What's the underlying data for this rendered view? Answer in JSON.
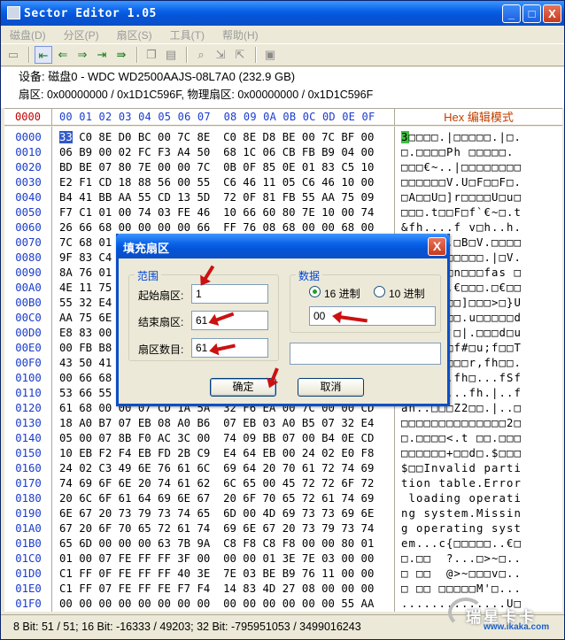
{
  "window": {
    "title": "Sector Editor 1.05",
    "buttons": {
      "minimize": "_",
      "maximize": "□",
      "close": "X"
    }
  },
  "menu": [
    "磁盘(D)",
    "分区(P)",
    "扇区(S)",
    "工具(T)",
    "帮助(H)"
  ],
  "info": {
    "line1": "设备: 磁盘0 - WDC WD2500AAJS-08L7A0 (232.9 GB)",
    "line2": "扇区: 0x00000000 / 0x1D1C596F, 物理扇区: 0x00000000 / 0x1D1C596F"
  },
  "hex_header": {
    "address_label": "0000",
    "columns": "00 01 02 03 04 05 06 07  08 09 0A 0B 0C 0D 0E 0F",
    "mode_label": "Hex 编辑模式"
  },
  "hex_rows": [
    {
      "addr": "0000",
      "first": "33",
      "hex": " C0 8E D0 BC 00 7C 8E  C0 8E D8 BE 00 7C BF 00",
      "text_first": "3",
      "text": "□□□□.|□□□□□.|□."
    },
    {
      "addr": "0010",
      "hex": "06 B9 00 02 FC F3 A4 50  68 1C 06 CB FB B9 04 00",
      "text": "□.□□□□Ph □□□□□."
    },
    {
      "addr": "0020",
      "hex": "BD BE 07 80 7E 00 00 7C  0B 0F 85 0E 01 83 C5 10",
      "text": "□□□€~..|□□□□□□□□"
    },
    {
      "addr": "0030",
      "hex": "E2 F1 CD 18 88 56 00 55  C6 46 11 05 C6 46 10 00",
      "text": "□□□□□□V.U□F□□F□."
    },
    {
      "addr": "0040",
      "hex": "B4 41 BB AA 55 CD 13 5D  72 0F 81 FB 55 AA 75 09",
      "text": "□A□□U□]r□□□□U□u□"
    },
    {
      "addr": "0050",
      "hex": "F7 C1 01 00 74 03 FE 46  10 66 60 80 7E 10 00 74",
      "text": "□□□.t□□F□f`€~□.t"
    },
    {
      "addr": "0060",
      "hex": "26 66 68 00 00 00 00 66  FF 76 08 68 00 00 68 00",
      "text": "&fh....f v□h..h."
    },
    {
      "addr": "0070",
      "hex": "7C 68 01 00 68 10 00 B4  42 8A 56 00 8B F4 CD 13",
      "text": "|h□.h□.□B□V.□□□□"
    },
    {
      "addr": "0080",
      "hex": "9F 83 C4 10 9E EB 14 B8  01 02 BB 00 7C 8A 56 00",
      "text": "□□□□□□□□□□□.|□V."
    },
    {
      "addr": "0090",
      "hex": "8A 76 01 8A 4E 02 8A 6E  03 CD 13 66 61 73 1C FE",
      "text": "□v□□N□□n□□□fas □"
    },
    {
      "addr": "00A0",
      "hex": "4E 11 75 0C 80 7E 00 80  0F 84 8A 00 B2 80 EB 84",
      "text": "N□u□€~.€□□□.□€□□"
    },
    {
      "addr": "00B0",
      "hex": "55 32 E4 8A 56 00 CD 13  5D EB 9E 81 3E FE 7D 55",
      "text": "U2□□V.□□]□□□>□}U"
    },
    {
      "addr": "00C0",
      "hex": "AA 75 6E FF 76 00 E8 8D  00 75 17 FA B0 D1 E6 64",
      "text": "□un□v.□□.u□□□□□d"
    },
    {
      "addr": "00D0",
      "hex": "E8 83 00 B0 DF E6 60 E8  7C 00 B0 FF E6 64 E8 75",
      "text": "□□.□□□`□|.□□□d□u"
    },
    {
      "addr": "00E0",
      "hex": "00 FB B8 00 BB CD 1A 66  23 C0 75 3B 66 81 FB 54",
      "text": ".□□.□□□f#□u;f□□T"
    },
    {
      "addr": "00F0",
      "hex": "43 50 41 75 32 81 F9 02  01 72 2C 66 68 07 BB 00",
      "text": "CPAu2□□□□r,fh□□."
    },
    {
      "addr": "0100",
      "hex": "00 66 68 00 02 00 00 66  68 08 00 00 00 66 53 66",
      "text": ".fh.□..fh□...fSf"
    },
    {
      "addr": "0110",
      "hex": "53 66 55 66 68 00 00 00  00 66 68 00 7C 00 00 66",
      "text": "SfUfh....fh.|..f"
    },
    {
      "addr": "0120",
      "hex": "61 68 00 00 07 CD 1A 5A  32 F6 EA 00 7C 00 00 CD",
      "text": "ah..□□□Z2□□.|..□"
    },
    {
      "addr": "0130",
      "hex": "18 A0 B7 07 EB 08 A0 B6  07 EB 03 A0 B5 07 32 E4",
      "text": "□□□□□□□□□□□□□□2□"
    },
    {
      "addr": "0140",
      "hex": "05 00 07 8B F0 AC 3C 00  74 09 BB 07 00 B4 0E CD",
      "text": "□.□□□□<.t □□.□□□"
    },
    {
      "addr": "0150",
      "hex": "10 EB F2 F4 EB FD 2B C9  E4 64 EB 00 24 02 E0 F8",
      "text": "□□□□□□+□□d□.$□□□"
    },
    {
      "addr": "0160",
      "hex": "24 02 C3 49 6E 76 61 6C  69 64 20 70 61 72 74 69",
      "text": "$□□Invalid parti"
    },
    {
      "addr": "0170",
      "hex": "74 69 6F 6E 20 74 61 62  6C 65 00 45 72 72 6F 72",
      "text": "tion table.Error"
    },
    {
      "addr": "0180",
      "hex": "20 6C 6F 61 64 69 6E 67  20 6F 70 65 72 61 74 69",
      "text": " loading operati"
    },
    {
      "addr": "0190",
      "hex": "6E 67 20 73 79 73 74 65  6D 00 4D 69 73 73 69 6E",
      "text": "ng system.Missin"
    },
    {
      "addr": "01A0",
      "hex": "67 20 6F 70 65 72 61 74  69 6E 67 20 73 79 73 74",
      "text": "g operating syst"
    },
    {
      "addr": "01B0",
      "hex": "65 6D 00 00 00 63 7B 9A  C8 F8 C8 F8 00 00 80 01",
      "text": "em...c{□□□□□..€□"
    },
    {
      "addr": "01C0",
      "hex": "01 00 07 FE FF FF 3F 00  00 00 01 3E 7E 03 00 00",
      "text": "□.□□  ?...□>~□.."
    },
    {
      "addr": "01D0",
      "hex": "C1 FF 0F FE FF FF 40 3E  7E 03 BE B9 76 11 00 00",
      "text": "□ □□  @>~□□□v□.."
    },
    {
      "addr": "01E0",
      "hex": "C1 FF 07 FE FF FE F7 F4  14 83 4D 27 08 00 00 00",
      "text": "□ □□ □□□□□M'□..."
    },
    {
      "addr": "01F0",
      "hex": "00 00 00 00 00 00 00 00  00 00 00 00 00 00 55 AA",
      "text": "..............U□"
    }
  ],
  "status": "8 Bit: 51 / 51;  16 Bit: -16333 / 49203;  32 Bit: -795951053 / 3499016243",
  "watermark": {
    "main": "瑞星卡卡",
    "sub": "www.ikaka.com"
  },
  "dialog": {
    "title": "填充扇区",
    "range_group": "范围",
    "start_label": "起始扇区:",
    "start_value": "1",
    "end_label": "结束扇区:",
    "end_value": "61",
    "count_label": "扇区数目:",
    "count_value": "61",
    "data_group": "数据",
    "radio_hex": "16 进制",
    "radio_dec": "10 进制",
    "data_value": "00",
    "extra_value": "",
    "ok": "确定",
    "cancel": "取消",
    "close": "X"
  },
  "colors": {
    "title_blue": "#0a63e8",
    "accent_red": "#cc1111",
    "addr_blue": "#1a3ccc"
  }
}
